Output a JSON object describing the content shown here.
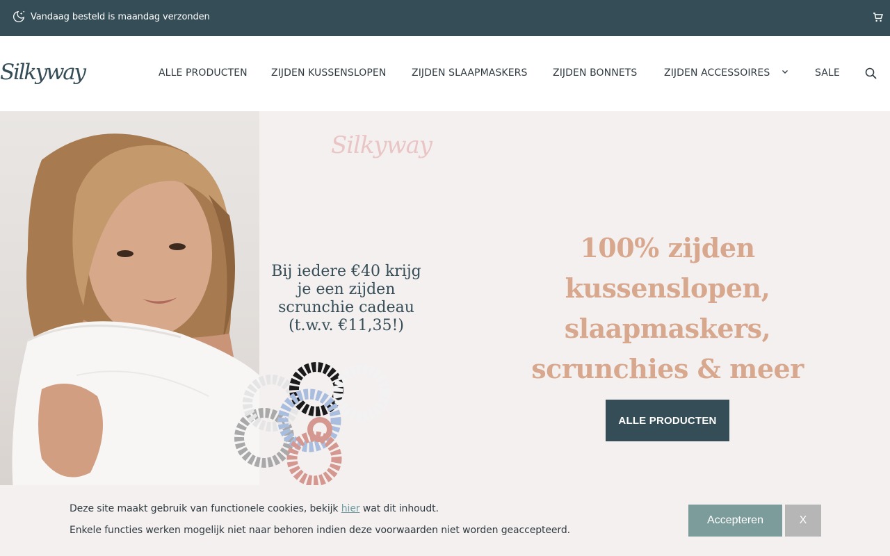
{
  "topbar": {
    "message": "Vandaag besteld is maandag verzonden",
    "message_icon": "moon-stars-icon",
    "cart_icon": "cart-icon"
  },
  "header": {
    "logo_text": "Silkyway",
    "nav": [
      {
        "label": "ALLE PRODUCTEN"
      },
      {
        "label": "ZIJDEN KUSSENSLOPEN"
      },
      {
        "label": "ZIJDEN SLAAPMASKERS"
      },
      {
        "label": "ZIJDEN BONNETS"
      },
      {
        "label": "ZIJDEN ACCESSOIRES",
        "has_dropdown": true
      },
      {
        "label": "SALE"
      }
    ],
    "search_icon": "search-icon"
  },
  "hero": {
    "logo_text": "Silkyway",
    "promo_lines": [
      "Bij iedere €40 krijg",
      "je een zijden",
      "scrunchie cadeau",
      "(t.w.v. €11,35!)"
    ],
    "headline_lines": [
      "100% zijden",
      "kussenslopen,",
      "slaapmaskers,",
      "scrunchies & meer"
    ],
    "cta_label": "ALLE PRODUCTEN"
  },
  "cookie": {
    "line1_before": "Deze site maakt gebruik van functionele cookies, bekijk ",
    "line1_link": "hier",
    "line1_after": " wat dit inhoudt.",
    "line2": "Enkele functies werken mogelijk niet naar behoren indien deze voorwaarden niet worden geaccepteerd.",
    "accept_label": "Accepteren",
    "close_label": "X"
  },
  "colors": {
    "topbar_bg": "#344d57",
    "hero_bg": "#f4f0ef",
    "headline": "#d8a88e",
    "accept_bg": "#7c9c9b",
    "close_bg": "#b6b6b6"
  }
}
